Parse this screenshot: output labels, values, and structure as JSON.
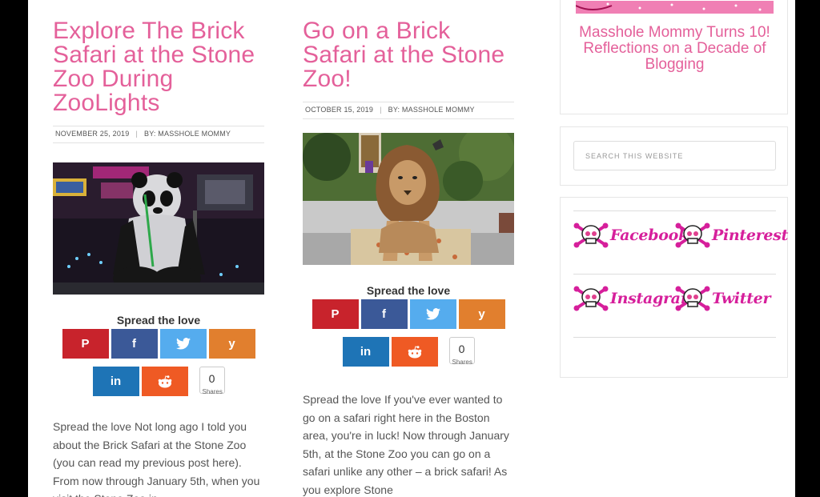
{
  "posts": [
    {
      "title": "Explore The Brick Safari at the Stone Zoo During ZooLights",
      "date": "NOVEMBER 25, 2019",
      "author": "BY: MASSHOLE MOMMY",
      "image": "brick panda sculpture at night",
      "spread_title": "Spread the love",
      "share_count": "0",
      "share_label": "Shares",
      "excerpt": "Spread the love        Not long ago I told you about the Brick Safari at the Stone Zoo (you can read my previous post here). From now through January 5th, when you visit the Stone Zoo in"
    },
    {
      "title": "Go on a Brick Safari at the Stone Zoo!",
      "date": "OCTOBER 15, 2019",
      "author": "BY: MASSHOLE MOMMY",
      "image": "brick lion sculpture",
      "spread_title": "Spread the love",
      "share_count": "0",
      "share_label": "Shares",
      "excerpt": "Spread the love        If you've ever wanted to go on a safari right here in the Boston area, you're in luck! Now through January 5th, at the Stone Zoo you can go on a safari unlike any other – a brick safari! As you explore Stone"
    }
  ],
  "share_buttons": {
    "pinterest": "P",
    "facebook": "f",
    "twitter": "t",
    "yummly": "y",
    "linkedin": "in",
    "reddit": "reddit"
  },
  "sidebar": {
    "featured_title": "Masshole Mommy Turns 10! Reflections on a Decade of Blogging",
    "search_placeholder": "SEARCH THIS WEBSITE",
    "social": {
      "facebook": "Facebook",
      "pinterest": "Pinterest",
      "instagram": "Instagram",
      "twitter": "Twitter"
    }
  },
  "colors": {
    "accent": "#e4609a",
    "social_pink": "#d61f9b",
    "pinterest": "#c8232c",
    "facebook": "#3b5998",
    "twitter": "#55acee",
    "yummly": "#e17f2e",
    "linkedin": "#1e74b6",
    "reddit": "#ef5a24"
  }
}
